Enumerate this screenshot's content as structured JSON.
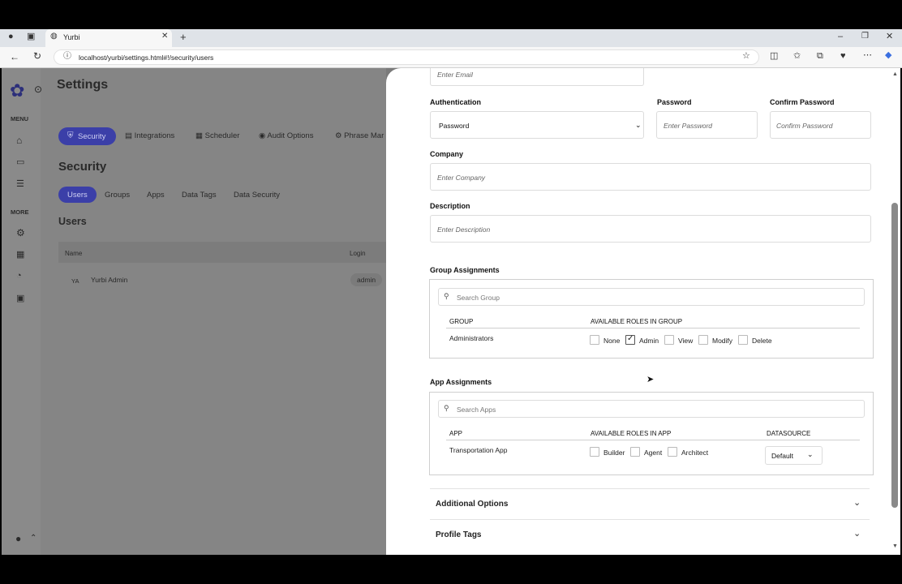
{
  "browser": {
    "tab_title": "Yurbi",
    "url": "localhost/yurbi/settings.html#!/security/users"
  },
  "app": {
    "page_title": "Settings",
    "sidebar": {
      "menu_label": "MENU",
      "more_label": "MORE"
    },
    "settings_tabs": [
      "Security",
      "Integrations",
      "Scheduler",
      "Audit Options",
      "Phrase Mar"
    ],
    "section_title": "Security",
    "sub_tabs": [
      "Users",
      "Groups",
      "Apps",
      "Data Tags",
      "Data Security"
    ],
    "users_title": "Users",
    "table": {
      "columns": [
        "Name",
        "Login"
      ],
      "rows": [
        {
          "initials": "YA",
          "name": "Yurbi Admin",
          "login": "admin"
        }
      ]
    }
  },
  "drawer": {
    "email_placeholder": "Enter Email",
    "auth_label": "Authentication",
    "auth_value": "Password",
    "password_label": "Password",
    "password_placeholder": "Enter Password",
    "confirm_label": "Confirm Password",
    "confirm_placeholder": "Confirm Password",
    "company_label": "Company",
    "company_placeholder": "Enter Company",
    "description_label": "Description",
    "description_placeholder": "Enter Description",
    "group_assign": {
      "title": "Group Assignments",
      "search_placeholder": "Search Group",
      "col_group": "GROUP",
      "col_roles": "AVAILABLE ROLES IN GROUP",
      "row_name": "Administrators",
      "roles": [
        "None",
        "Admin",
        "View",
        "Modify",
        "Delete"
      ],
      "checked_role": "Admin"
    },
    "app_assign": {
      "title": "App Assignments",
      "search_placeholder": "Search Apps",
      "col_app": "APP",
      "col_roles": "AVAILABLE ROLES IN APP",
      "col_ds": "DATASOURCE",
      "row_name": "Transportation App",
      "roles": [
        "Builder",
        "Agent",
        "Architect"
      ],
      "datasource": "Default"
    },
    "additional_options": "Additional Options",
    "profile_tags": "Profile Tags"
  },
  "colors": {
    "accent": "#3b3fa8",
    "overlay_bg": "#7a7a7a",
    "drawer_bg": "#ffffff"
  }
}
